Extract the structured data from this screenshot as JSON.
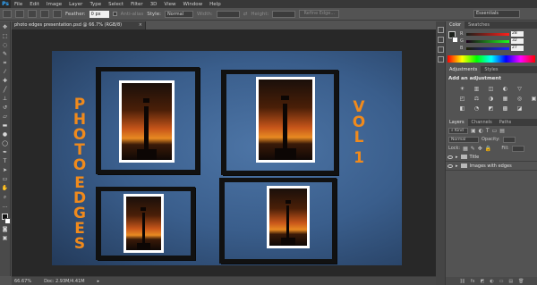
{
  "app": {
    "logo": "Ps"
  },
  "menu": [
    "File",
    "Edit",
    "Image",
    "Layer",
    "Type",
    "Select",
    "Filter",
    "3D",
    "View",
    "Window",
    "Help"
  ],
  "options": {
    "feather_label": "Feather:",
    "feather_value": "0 px",
    "antialias_label": "Anti-alias",
    "style_label": "Style:",
    "style_value": "Normal",
    "width_label": "Width:",
    "height_label": "Height:",
    "refine_label": "Refine Edge...",
    "workspace": "Essentials"
  },
  "document": {
    "tab_title": "photo edges presentation.psd @ 66.7% (RGB/8)",
    "close": "×"
  },
  "canvas": {
    "left_text": [
      "P",
      "H",
      "O",
      "T",
      "O",
      " ",
      "E",
      "D",
      "G",
      "E",
      "S"
    ],
    "right_text": [
      "V",
      "O",
      "L",
      " ",
      "1"
    ]
  },
  "status": {
    "zoom": "66.67%",
    "doc": "Doc: 2.93M/4.41M"
  },
  "color_panel": {
    "tabs": [
      "Color",
      "Swatches"
    ],
    "channels": [
      {
        "label": "R",
        "value": "28",
        "color": "#ff2a2a"
      },
      {
        "label": "G",
        "value": "32",
        "color": "#2aff2a"
      },
      {
        "label": "B",
        "value": "27",
        "color": "#2a5aff"
      }
    ]
  },
  "adjustments_panel": {
    "tabs": [
      "Adjustments",
      "Styles"
    ],
    "title": "Add an adjustment",
    "icons": [
      "☀",
      "▥",
      "◫",
      "◐",
      "▽",
      "◰",
      "⚖",
      "◑",
      "▦",
      "◎",
      "▣",
      "◧",
      "◔",
      "◩",
      "▩",
      "◪",
      "◨"
    ]
  },
  "layers_panel": {
    "tabs": [
      "Layers",
      "Channels",
      "Paths"
    ],
    "kind": "Kind",
    "blend": "Normal",
    "opacity_label": "Opacity:",
    "lock_label": "Lock:",
    "fill_label": "Fill:",
    "layers": [
      {
        "name": "Title"
      },
      {
        "name": "Images with edges"
      }
    ],
    "footer_icons": [
      "⛓",
      "fx",
      "◩",
      "◐",
      "▭",
      "▤",
      "🗑"
    ]
  }
}
